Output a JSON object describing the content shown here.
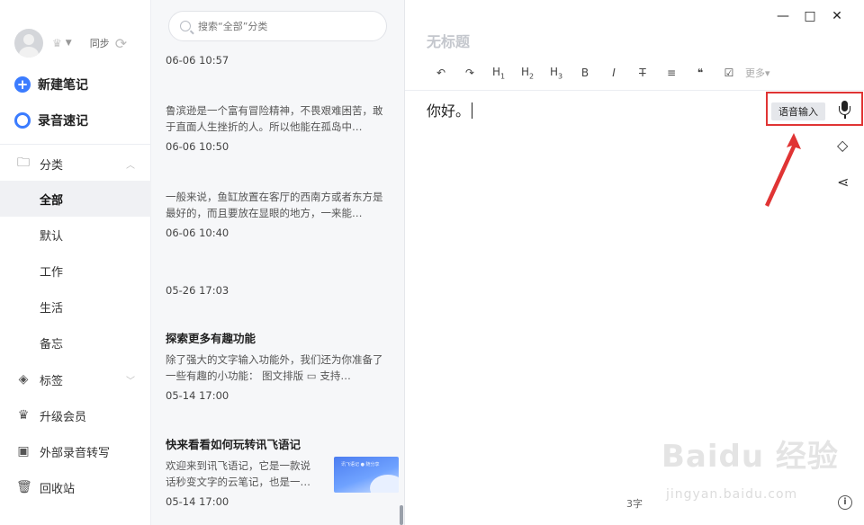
{
  "sidebar": {
    "sync_label": "同步",
    "new_note": "新建笔记",
    "voice_note": "录音速记",
    "categories_label": "分类",
    "subitems": [
      "全部",
      "默认",
      "工作",
      "生活",
      "备忘"
    ],
    "tags_label": "标签",
    "upgrade_label": "升级会员",
    "transcribe_label": "外部录音转写",
    "trash_label": "回收站"
  },
  "list": {
    "search_placeholder": "搜索“全部”分类",
    "notes": [
      {
        "title": "",
        "preview": "",
        "date": "06-06 10:57"
      },
      {
        "title": "",
        "preview": "鲁滨逊是一个富有冒险精神，不畏艰难困苦，敢于直面人生挫折的人。所以他能在孤岛中…",
        "date": "06-06 10:50"
      },
      {
        "title": "",
        "preview": "一般来说，鱼缸放置在客厅的西南方或者东方是最好的，而且要放在显眼的地方，一来能…",
        "date": "06-06 10:40"
      },
      {
        "title": "",
        "preview": "",
        "date": "05-26 17:03"
      },
      {
        "title": "探索更多有趣功能",
        "preview": "除了强大的文字输入功能外，我们还为你准备了一些有趣的小功能：   图文排版 ▭ 支持…",
        "date": "05-14 17:00"
      },
      {
        "title": "快来看看如何玩转讯飞语记",
        "preview": "欢迎来到讯飞语记，它是一款说话秒变文字的云笔记，也是一…",
        "date": "05-14 17:00",
        "thumb_text": "讯飞语记 ● 随分享"
      }
    ]
  },
  "editor": {
    "title_placeholder": "无标题",
    "toolbar": {
      "undo": "↶",
      "redo": "↷",
      "h1": "H",
      "h2": "H",
      "h3": "H",
      "h1_sub": "1",
      "h2_sub": "2",
      "h3_sub": "3",
      "bold": "B",
      "italic": "I",
      "strike": "T̶",
      "align": "≡",
      "quote": "❝",
      "checkbox": "☑",
      "more": "更多▾"
    },
    "content": "你好。",
    "voice_input": "语音输入",
    "word_count": "3字",
    "info": "i"
  },
  "window": {
    "minimize": "—",
    "maximize": "□",
    "close": "✕"
  },
  "watermark": {
    "main": "Baidu 经验",
    "sub": "jingyan.baidu.com"
  },
  "colors": {
    "accent": "#3b7cff",
    "highlight": "#e03434"
  }
}
